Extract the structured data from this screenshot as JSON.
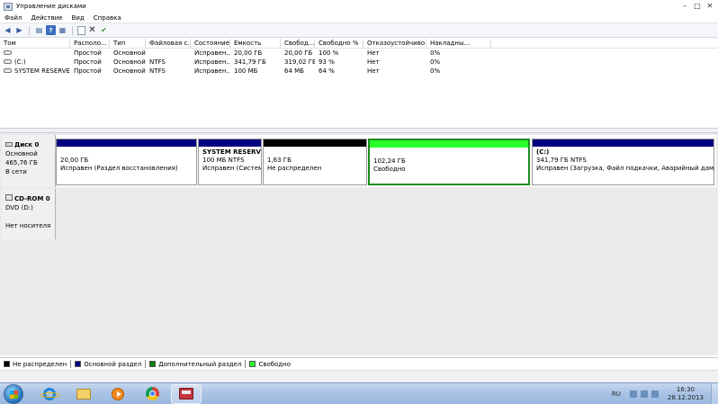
{
  "window": {
    "title": "Управление дисками",
    "controls": [
      "minimize",
      "maximize",
      "close"
    ]
  },
  "menu": [
    "Файл",
    "Действие",
    "Вид",
    "Справка"
  ],
  "toolbar": {
    "icons": [
      "back-arrow-icon",
      "forward-arrow-icon",
      "list-view-icon",
      "help-icon",
      "disk-view-icon",
      "properties-icon",
      "delete-icon",
      "check-disk-icon"
    ],
    "help_label": "?"
  },
  "volume_table": {
    "columns": [
      "Том",
      "Располо...",
      "Тип",
      "Файловая с...",
      "Состояние",
      "Емкость",
      "Свобод...",
      "Свободно %",
      "Отказоустойчиво...",
      "Накладны..."
    ],
    "rows": [
      [
        "",
        "Простой",
        "Основной",
        "",
        "Исправен...",
        "20,00 ГБ",
        "20,00 ГБ",
        "100 %",
        "Нет",
        "0%"
      ],
      [
        "(C:)",
        "Простой",
        "Основной",
        "NTFS",
        "Исправен...",
        "341,79 ГБ",
        "319,02 ГБ",
        "93 %",
        "Нет",
        "0%"
      ],
      [
        "SYSTEM RESERVED",
        "Простой",
        "Основной",
        "NTFS",
        "Исправен...",
        "100 МБ",
        "64 МБ",
        "64 %",
        "Нет",
        "0%"
      ]
    ]
  },
  "disks": [
    {
      "name": "Диск 0",
      "type": "Основной",
      "size": "465,76 ГБ",
      "status": "В сети",
      "partitions": [
        {
          "label": "",
          "line1": "20,00 ГБ",
          "line2": "Исправен (Раздел восстановления)",
          "kind": "primary"
        },
        {
          "label": "SYSTEM RESERVED",
          "line1": "100 МБ NTFS",
          "line2": "Исправен (Система",
          "kind": "primary"
        },
        {
          "label": "",
          "line1": "1,63 ГБ",
          "line2": "Не распределен",
          "kind": "unallocated"
        },
        {
          "label": "",
          "line1": "102,24 ГБ",
          "line2": "Свободно",
          "kind": "free"
        },
        {
          "label": "(C:)",
          "line1": "341,79 ГБ NTFS",
          "line2": "Исправен (Загрузка, Файл подкачки, Аварийный дамп памя",
          "kind": "primary"
        }
      ]
    },
    {
      "name": "CD-ROM 0",
      "type": "DVD (D:)",
      "size": "",
      "status": "Нет носителя"
    }
  ],
  "legend": [
    {
      "label": "Не распределен",
      "color": "#000000"
    },
    {
      "label": "Основной раздел",
      "color": "#000080"
    },
    {
      "label": "Дополнительный раздел",
      "color": "#008000"
    },
    {
      "label": "Свободно",
      "color": "#28ff28"
    }
  ],
  "taskbar": {
    "apps": [
      "internet-explorer-icon",
      "explorer-folder-icon",
      "media-player-icon",
      "chrome-icon",
      "disk-management-icon"
    ],
    "language": "RU",
    "time": "16:30",
    "date": "28.12.2013"
  }
}
